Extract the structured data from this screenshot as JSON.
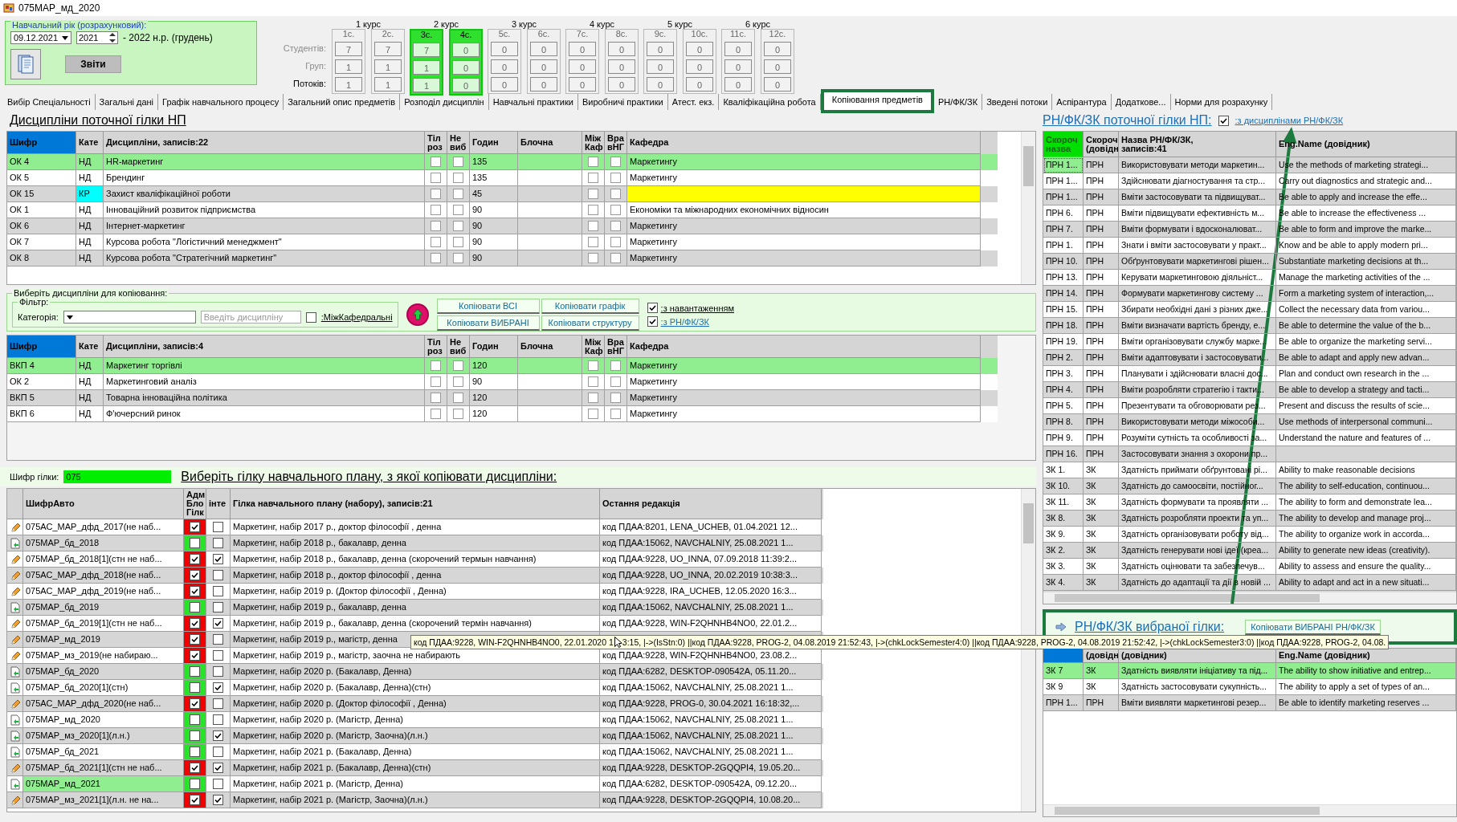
{
  "window": {
    "title": "075МАР_мд_2020"
  },
  "year_panel": {
    "legend": "Навчальний рік (розрахунковий):",
    "date": "09.12.2021",
    "year": "2021",
    "year_range": "- 2022 н.р. (грудень)",
    "reports_button": "Звіти"
  },
  "semester_grid": {
    "courses": [
      "1 курс",
      "2 курс",
      "3 курс",
      "4 курс",
      "5 курс",
      "6 курс"
    ],
    "row_labels": [
      {
        "label": "Студентів:",
        "disabled": true
      },
      {
        "label": "Груп:",
        "disabled": true
      },
      {
        "label": "Потоків:",
        "disabled": false
      }
    ],
    "semesters": [
      {
        "label": "1с.",
        "values": [
          "7",
          "1",
          "1"
        ],
        "selected": false
      },
      {
        "label": "2с.",
        "values": [
          "7",
          "1",
          "1"
        ],
        "selected": false
      },
      {
        "label": "3с.",
        "values": [
          "7",
          "1",
          "1"
        ],
        "selected": true
      },
      {
        "label": "4с.",
        "values": [
          "0",
          "0",
          "0"
        ],
        "selected": true
      },
      {
        "label": "5с.",
        "values": [
          "0",
          "0",
          "0"
        ],
        "selected": false
      },
      {
        "label": "6с.",
        "values": [
          "0",
          "0",
          "0"
        ],
        "selected": false
      },
      {
        "label": "7с.",
        "values": [
          "0",
          "0",
          "0"
        ],
        "selected": false
      },
      {
        "label": "8с.",
        "values": [
          "0",
          "0",
          "0"
        ],
        "selected": false
      },
      {
        "label": "9с.",
        "values": [
          "0",
          "0",
          "0"
        ],
        "selected": false
      },
      {
        "label": "10с.",
        "values": [
          "0",
          "0",
          "0"
        ],
        "selected": false
      },
      {
        "label": "11с.",
        "values": [
          "0",
          "0",
          "0"
        ],
        "selected": false
      },
      {
        "label": "12с.",
        "values": [
          "0",
          "0",
          "0"
        ],
        "selected": false
      }
    ]
  },
  "tabs": [
    {
      "label": "Вибір Спеціальності",
      "selected": false
    },
    {
      "label": "Загальні дані",
      "selected": false
    },
    {
      "label": "Графік навчального процесу",
      "selected": false
    },
    {
      "label": "Загальний опис предметів",
      "selected": false
    },
    {
      "label": "Розподіл дисциплін",
      "selected": false
    },
    {
      "label": "Навчальні практики",
      "selected": false
    },
    {
      "label": "Виробничі практики",
      "selected": false
    },
    {
      "label": "Атест. екз.",
      "selected": false
    },
    {
      "label": "Кваліфікаційна робота",
      "selected": false
    },
    {
      "label": "Копіювання предметів",
      "selected": true
    },
    {
      "label": "РН/ФК/ЗК",
      "selected": false
    },
    {
      "label": "Зведені потоки",
      "selected": false
    },
    {
      "label": "Аспірантура",
      "selected": false
    },
    {
      "label": "Додаткове...",
      "selected": false
    },
    {
      "label": "Норми для розрахунку",
      "selected": false
    }
  ],
  "current_disciplines": {
    "title": "Дисципліни поточної гілки НП",
    "columns": [
      "Шифр",
      "Кате",
      "Дисципліни, записів:22",
      "Тіл\nроз",
      "Не\nвиб",
      "Годин",
      "Блочна",
      "Між\nКаф",
      "Вра\nвНГ",
      "Кафедра"
    ],
    "rows": [
      {
        "code": "ОК 4",
        "category": "НД",
        "name": "HR-маркетинг",
        "hours": "135",
        "department": "Маркетингу",
        "checks": [
          false,
          false,
          false,
          false
        ],
        "flagged": false,
        "department_missing": false,
        "selected": true
      },
      {
        "code": "ОК 5",
        "category": "НД",
        "name": "Брендинг",
        "hours": "135",
        "department": "Маркетингу",
        "checks": [
          false,
          false,
          false,
          false
        ],
        "flagged": false,
        "department_missing": false,
        "selected": false
      },
      {
        "code": "ОК 15",
        "category": "КР",
        "name": "Захист кваліфікаційної роботи",
        "hours": "45",
        "checks": [
          false,
          false,
          false,
          false
        ],
        "flagged": true,
        "department_missing": true,
        "selected": false
      },
      {
        "code": "ОК 1",
        "category": "НД",
        "name": "Інноваційний розвиток підприємства",
        "hours": "90",
        "department": "Економіки та міжнародних економічних відносин",
        "checks": [
          false,
          false,
          false,
          false
        ],
        "flagged": false,
        "department_missing": false,
        "selected": false
      },
      {
        "code": "ОК 6",
        "category": "НД",
        "name": "Інтернет-маркетинг",
        "hours": "90",
        "department": "Маркетингу",
        "checks": [
          false,
          false,
          false,
          false
        ],
        "flagged": false,
        "department_missing": false,
        "selected": false
      },
      {
        "code": "ОК 7",
        "category": "НД",
        "name": "Курсова робота \"Логістичний менеджмент\"",
        "hours": "90",
        "department": "Маркетингу",
        "checks": [
          false,
          false,
          false,
          false
        ],
        "flagged": false,
        "department_missing": false,
        "selected": false
      },
      {
        "code": "ОК 8",
        "category": "НД",
        "name": "Курсова робота \"Стратегічний маркетинг\"",
        "hours": "90",
        "department": "Маркетингу",
        "checks": [
          false,
          false,
          false,
          false
        ],
        "flagged": false,
        "department_missing": false,
        "selected": false
      }
    ]
  },
  "copy_panel": {
    "legend": "Виберіть дисципліни для копіювання:",
    "filter_legend": "Фільтр:",
    "category_label": "Категорія:",
    "discipline_placeholder": "Введіть дисципліну",
    "interdepartmental": {
      "label": ":МіжКафедральні",
      "checked": false
    },
    "buttons": [
      "Копіювати ВСІ",
      "Копіювати графік",
      "Копіювати ВИБРАНІ",
      "Копіювати структуру"
    ],
    "options": [
      {
        "label": ":з навантаженням",
        "checked": true,
        "kind": "text"
      },
      {
        "label": ":з РН/ФК/ЗК",
        "checked": true,
        "kind": "link"
      }
    ]
  },
  "selected_disciplines": {
    "columns": [
      "Шифр",
      "Кате",
      "Дисципліни, записів:4",
      "Тіл\nроз",
      "Не\nвиб",
      "Годин",
      "Блочна",
      "Між\nКаф",
      "Вра\nвНГ",
      "Кафедра"
    ],
    "rows": [
      {
        "code": "ВКП 4",
        "category": "НД",
        "name": "Маркетинг торгівлі",
        "hours": "120",
        "department": "Маркетингу",
        "checks": [
          false,
          false,
          false,
          false
        ],
        "flagged": false,
        "department_missing": false,
        "selected": true
      },
      {
        "code": "ОК 2",
        "category": "НД",
        "name": "Маркетинговий аналіз",
        "hours": "90",
        "department": "Маркетингу",
        "checks": [
          false,
          false,
          false,
          false
        ],
        "flagged": false,
        "department_missing": false,
        "selected": false
      },
      {
        "code": "ВКП 5",
        "category": "НД",
        "name": "Товарна інноваційна політика",
        "hours": "120",
        "department": "Маркетингу",
        "checks": [
          false,
          false,
          false,
          false
        ],
        "flagged": false,
        "department_missing": false,
        "selected": false
      },
      {
        "code": "ВКП 6",
        "category": "НД",
        "name": "Ф'ючерсний ринок",
        "hours": "120",
        "department": "Маркетингу",
        "checks": [
          false,
          false,
          false,
          false
        ],
        "flagged": false,
        "department_missing": false,
        "selected": false
      }
    ]
  },
  "branch": {
    "code_label": "Шифр гілки:",
    "code": "075",
    "prompt": "Виберіть гілку навчального плану, з якої копіювати дисципліни:"
  },
  "branches": {
    "columns": [
      "ШифрАвто",
      "Адм\nБло\nГілк",
      "інте",
      "Гілка навчального плану (набору), записів:21",
      "Остання редакція"
    ],
    "rows": [
      {
        "kind": "pencil",
        "code": "075АС_МАР_дфд_2017(не наб...",
        "locked": true,
        "integration": false,
        "name": "Маркетинг, набір 2017 р., доктор філософії , денна",
        "last_edit": "код ПДАА:8201, LENA_UCHEB, 01.04.2021 12...",
        "selected": false
      },
      {
        "kind": "document",
        "code": "075МАР_бд_2018",
        "locked": false,
        "integration": false,
        "name": "Маркетинг, набір 2018 р., бакалавр, денна",
        "last_edit": "код ПДАА:15062, NAVCHALNIY, 25.08.2021 1...",
        "selected": false
      },
      {
        "kind": "pencil",
        "code": "075МАР_бд_2018[1](стн не наб...",
        "locked": true,
        "integration": true,
        "name": "Маркетинг, набір 2018 р., бакалавр, денна (скорочений термын навчання)",
        "last_edit": "код ПДАА:9228, UO_INNA, 07.09.2018 11:39:2...",
        "selected": false
      },
      {
        "kind": "pencil",
        "code": "075АС_МАР_дфд_2018(не наб...",
        "locked": true,
        "integration": false,
        "name": "Маркетинг, набір 2018 р., доктор філософії , денна",
        "last_edit": "код ПДАА:9228, UO_INNA, 20.02.2019 10:38:3...",
        "selected": false
      },
      {
        "kind": "pencil",
        "code": "075АС_МАР_дфд_2019(не наб...",
        "locked": true,
        "integration": false,
        "name": "Маркетинг, набір 2019 р. (Доктор філософії , Денна)",
        "last_edit": "код ПДАА:9228, IRA_UCHEB, 12.05.2020 16:3...",
        "selected": false
      },
      {
        "kind": "document",
        "code": "075МАР_бд_2019",
        "locked": false,
        "integration": false,
        "name": "Маркетинг, набір 2019 р., бакалавр, денна",
        "last_edit": "код ПДАА:15062, NAVCHALNIY, 25.08.2021 1...",
        "selected": false
      },
      {
        "kind": "pencil",
        "code": "075МАР_бд_2019[1](стн не наб...",
        "locked": true,
        "integration": true,
        "name": "Маркетинг, набір 2019 р., бакалавр, денна (скорочений термін навчання)",
        "last_edit": "код ПДАА:9228, WIN-F2QHNHB4NO0, 22.01.2...",
        "selected": false
      },
      {
        "kind": "pencil",
        "code": "075МАР_мд_2019",
        "locked": true,
        "integration": false,
        "name": "Маркетинг, набір 2019 р., магістр, денна",
        "selected": false,
        "tooltip": [
          "код ПДАА:9228, WIN-F2QHNHB4NO0, 22.01.2020 1",
          "3:15, |->(IsStn:0) ||код ПДАА:9228, PROG-2, 04.08.2019 21:52:43, |->(chkLockSemester4:0) ||код ПДАА:9228, PROG-2, 04.08.2019 21:52:42, |->(chkLockSemester3:0) ||код ПДАА:9228, PROG-2, 04.08."
        ]
      },
      {
        "kind": "pencil",
        "code": "075МАР_мз_2019(не набираю...",
        "locked": true,
        "integration": false,
        "name": "Маркетинг, набір 2019 р., магістр, заочна не набирають",
        "last_edit": "код ПДАА:9228, WIN-F2QHNHB4NO0, 23.08.2...",
        "selected": false
      },
      {
        "kind": "document",
        "code": "075МАР_бд_2020",
        "locked": false,
        "integration": false,
        "name": "Маркетинг, набір 2020 р. (Бакалавр, Денна)",
        "last_edit": "код ПДАА:6282, DESKTOP-090542A, 05.11.20...",
        "selected": false
      },
      {
        "kind": "document",
        "code": "075МАР_бд_2020[1](стн)",
        "locked": false,
        "integration": true,
        "name": "Маркетинг, набір 2020 р. (Бакалавр, Денна)(стн)",
        "last_edit": "код ПДАА:15062, NAVCHALNIY, 25.08.2021 1...",
        "selected": false
      },
      {
        "kind": "pencil",
        "code": "075АС_МАР_дфд_2020(не наб...",
        "locked": true,
        "integration": false,
        "name": "Маркетинг, набір 2020 р. (Доктор філософії , Денна)",
        "last_edit": "код ПДАА:9228, PROG-0, 30.04.2021 16:18:32,...",
        "selected": false
      },
      {
        "kind": "document",
        "code": "075МАР_мд_2020",
        "locked": false,
        "integration": false,
        "name": "Маркетинг, набір 2020 р. (Магістр, Денна)",
        "last_edit": "код ПДАА:15062, NAVCHALNIY, 25.08.2021 1...",
        "selected": false
      },
      {
        "kind": "document",
        "code": "075МАР_мз_2020[1](л.н.)",
        "locked": false,
        "integration": true,
        "name": "Маркетинг, набір 2020 р. (Магістр, Заочна)(л.н.)",
        "last_edit": "код ПДАА:15062, NAVCHALNIY, 25.08.2021 1...",
        "selected": false
      },
      {
        "kind": "document",
        "code": "075МАР_бд_2021",
        "locked": false,
        "integration": false,
        "name": "Маркетинг, набір 2021 р. (Бакалавр, Денна)",
        "last_edit": "код ПДАА:15062, NAVCHALNIY, 25.08.2021 1...",
        "selected": false
      },
      {
        "kind": "pencil",
        "code": "075МАР_бд_2021[1](стн не наб...",
        "locked": true,
        "integration": true,
        "name": "Маркетинг, набір 2021 р. (Бакалавр, Денна)(стн)",
        "last_edit": "код ПДАА:9228, DESKTOP-2GQQPI4, 19.05.20...",
        "selected": false
      },
      {
        "kind": "document",
        "code": "075МАР_мд_2021",
        "locked": false,
        "integration": false,
        "name": "Маркетинг, набір 2021 р. (Магістр, Денна)",
        "last_edit": "код ПДАА:6282, DESKTOP-090542A, 09.12.20...",
        "selected": true
      },
      {
        "kind": "pencil",
        "code": "075МАР_мз_2021[1](л.н. не на...",
        "locked": true,
        "integration": true,
        "name": "Маркетинг, набір 2021 р. (Магістр, Заочна)(л.н.)",
        "last_edit": "код ПДАА:9228, DESKTOP-2GQQPI4, 10.08.20...",
        "selected": false
      }
    ]
  },
  "learning_outcomes": {
    "title": "РН/ФК/ЗК поточної гілки НП:",
    "with_disciplines": {
      "label": ":з дисциплінами РН/ФК/ЗК",
      "checked": true
    },
    "columns": [
      "Скороч\nназва",
      "Скороч\n(довідн",
      "Назва РН/ФК/ЗК,\nзаписів:41",
      "Eng.Name (довідник)"
    ],
    "rows": [
      {
        "short": "ПРН 1...",
        "type": "ПРН",
        "name": "Використовувати методи маркетин...",
        "eng": "Use the methods of marketing strategi...",
        "selected": true
      },
      {
        "short": "ПРН 1...",
        "type": "ПРН",
        "name": "Здійснювати діагностування та стр...",
        "eng": "Carry out diagnostics and strategic and...",
        "selected": false
      },
      {
        "short": "ПРН 1...",
        "type": "ПРН",
        "name": "Вміти застосовувати та підвищуват...",
        "eng": "Be able to apply and increase the effe...",
        "selected": false
      },
      {
        "short": "ПРН 6.",
        "type": "ПРН",
        "name": "Вміти підвищувати ефективність м...",
        "eng": "Be able to increase the effectiveness ...",
        "selected": false
      },
      {
        "short": "ПРН 7.",
        "type": "ПРН",
        "name": "Вміти формувати і вдосконалюват...",
        "eng": "Be able to form and improve the marke...",
        "selected": false
      },
      {
        "short": "ПРН 1.",
        "type": "ПРН",
        "name": "Знати і вміти застосовувати у практ...",
        "eng": "Know and be able to apply modern pri...",
        "selected": false
      },
      {
        "short": "ПРН 10.",
        "type": "ПРН",
        "name": "Обґрунтовувати маркетингові рішен...",
        "eng": "Substantiate marketing decisions at th...",
        "selected": false
      },
      {
        "short": "ПРН 13.",
        "type": "ПРН",
        "name": "Керувати маркетинговою діяльніст...",
        "eng": "Manage the marketing activities of the ...",
        "selected": false
      },
      {
        "short": "ПРН 14.",
        "type": "ПРН",
        "name": "Формувати маркетингову систему ...",
        "eng": "Form a marketing system of interaction,...",
        "selected": false
      },
      {
        "short": "ПРН 15.",
        "type": "ПРН",
        "name": "Збирати необхідні дані з різних дже...",
        "eng": "Collect the necessary data from variou...",
        "selected": false
      },
      {
        "short": "ПРН 18.",
        "type": "ПРН",
        "name": "Вміти визначати вартість бренду, е...",
        "eng": "Be able to determine the value of the b...",
        "selected": false
      },
      {
        "short": "ПРН 19.",
        "type": "ПРН",
        "name": "Вміти організовувати службу марке...",
        "eng": "Be able to organize the marketing servi...",
        "selected": false
      },
      {
        "short": "ПРН 2.",
        "type": "ПРН",
        "name": "Вміти адаптовувати і застосовувати...",
        "eng": "Be able to adapt and apply new advan...",
        "selected": false
      },
      {
        "short": "ПРН 3.",
        "type": "ПРН",
        "name": "Планувати і здійснювати власні дос...",
        "eng": "Plan and conduct own research in the ...",
        "selected": false
      },
      {
        "short": "ПРН 4.",
        "type": "ПРН",
        "name": "Вміти розробляти стратегію і такти...",
        "eng": "Be able to develop a strategy and tacti...",
        "selected": false
      },
      {
        "short": "ПРН 5.",
        "type": "ПРН",
        "name": "Презентувати та обговорювати рез...",
        "eng": "Present and discuss the results of scie...",
        "selected": false
      },
      {
        "short": "ПРН 8.",
        "type": "ПРН",
        "name": "Використовувати методи міжособи...",
        "eng": "Use methods of interpersonal communi...",
        "selected": false
      },
      {
        "short": "ПРН 9.",
        "type": "ПРН",
        "name": "Розуміти сутність та особливості за...",
        "eng": "Understand the nature and features of ...",
        "selected": false
      },
      {
        "short": "ПРН 16.",
        "type": "ПРН",
        "name": "Застосовувати знання з охорони пр...",
        "selected": false
      },
      {
        "short": "ЗК 1.",
        "type": "ЗК",
        "name": "Здатність приймати обґрунтовані рі...",
        "eng": "Ability to make reasonable decisions",
        "selected": false
      },
      {
        "short": "ЗК 10.",
        "type": "ЗК",
        "name": "Здатність до самоосвіти, постійног...",
        "eng": "The ability to self-education, continuou...",
        "selected": false
      },
      {
        "short": "ЗК 11.",
        "type": "ЗК",
        "name": "Здатність формувати та проявляти ...",
        "eng": "The ability to form and demonstrate lea...",
        "selected": false
      },
      {
        "short": "ЗК 8.",
        "type": "ЗК",
        "name": "Здатність розробляти проекти та уп...",
        "eng": "The ability to develop and manage proj...",
        "selected": false
      },
      {
        "short": "ЗК 9.",
        "type": "ЗК",
        "name": "Здатність організовувати роботу від...",
        "eng": "The ability to organize work in accorda...",
        "selected": false
      },
      {
        "short": "ЗК 2.",
        "type": "ЗК",
        "name": "Здатність генерувати нові ідеї (креа...",
        "eng": "Ability to generate new ideas (creativity).",
        "selected": false
      },
      {
        "short": "ЗК 3.",
        "type": "ЗК",
        "name": "Здатність оцінювати та забезпечув...",
        "eng": "Ability to assess and ensure the quality...",
        "selected": false
      },
      {
        "short": "ЗК 4.",
        "type": "ЗК",
        "name": "Здатність до адаптації та дії в новій ...",
        "eng": "Ability to adapt and act in a new situati...",
        "selected": false
      }
    ]
  },
  "selected_branch_outcomes": {
    "title": "РН/ФК/ЗК вибраної гілки:",
    "copy_button": "Копіювати ВИБРАНІ РН/ФК/ЗК",
    "columns": [
      "(довідн",
      "(довідник)",
      "Eng.Name (довідник)"
    ],
    "rows": [
      {
        "short": "ЗК 7",
        "type": "ЗК",
        "name": "Здатність виявляти ініціативу та під...",
        "eng": "The ability to show initiative and entrep...",
        "selected": true
      },
      {
        "short": "ЗК 9",
        "type": "ЗК",
        "name": "Здатність застосовувати сукупність...",
        "eng": "The ability to apply a set of types of an...",
        "selected": false
      },
      {
        "short": "ПРН 1...",
        "type": "ПРН",
        "name": "Вміти виявляти маркетингові резер...",
        "eng": "Be able to identify marketing reserves ...",
        "selected": false
      }
    ]
  }
}
